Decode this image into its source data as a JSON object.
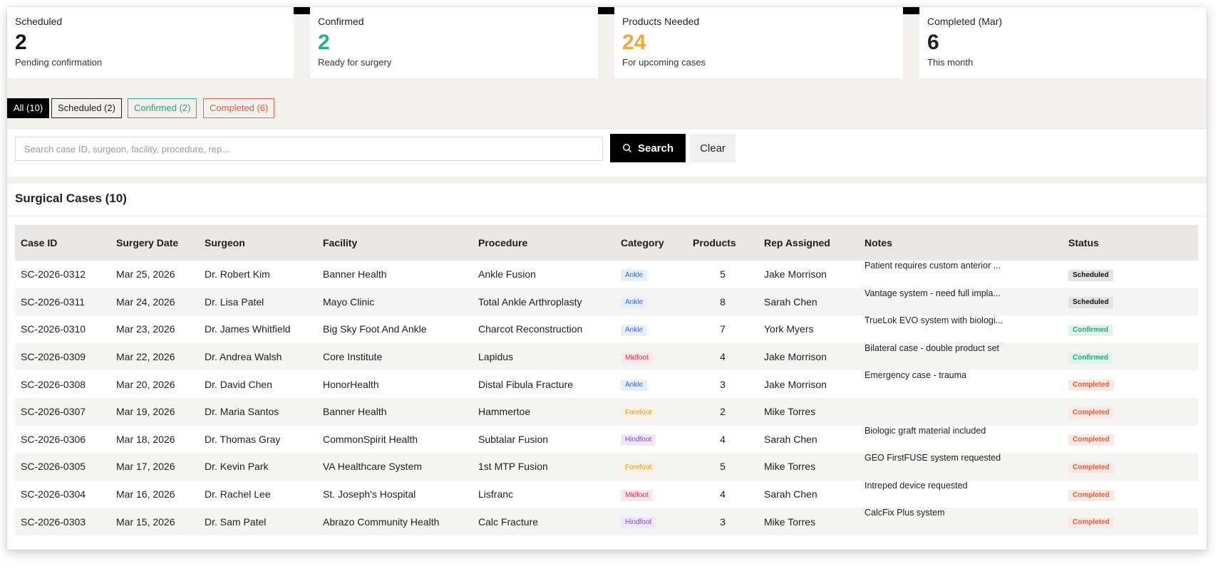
{
  "colors": {
    "confirmed_accent": "#22b28a",
    "products_accent": "#f2a93b",
    "completed_accent": "#e0603f"
  },
  "stats": [
    {
      "label": "Scheduled",
      "value": "2",
      "sub": "Pending confirmation",
      "color": "#111111"
    },
    {
      "label": "Confirmed",
      "value": "2",
      "sub": "Ready for surgery",
      "color": "#22b28a"
    },
    {
      "label": "Products Needed",
      "value": "24",
      "sub": "For upcoming cases",
      "color": "#f2a93b"
    },
    {
      "label": "Completed (Mar)",
      "value": "6",
      "sub": "This month",
      "color": "#222222"
    }
  ],
  "filters": {
    "all": "All (10)",
    "scheduled": "Scheduled (2)",
    "confirmed": "Confirmed (2)",
    "completed": "Completed (6)"
  },
  "search": {
    "placeholder": "Search case ID, surgeon, facility, procedure, rep...",
    "value": "",
    "button_label": "Search",
    "icon": "search-icon",
    "clear_label": "Clear"
  },
  "table": {
    "title": "Surgical Cases (10)",
    "columns": [
      "Case ID",
      "Surgery Date",
      "Surgeon",
      "Facility",
      "Procedure",
      "Category",
      "Products",
      "Rep Assigned",
      "Notes",
      "Status"
    ],
    "rows": [
      {
        "case_id": "SC-2026-0312",
        "date": "Mar 25, 2026",
        "surgeon": "Dr. Robert Kim",
        "facility": "Banner Health",
        "procedure": "Ankle Fusion",
        "category": "Ankle",
        "products": "5",
        "rep": "Jake Morrison",
        "notes": "Patient requires custom anterior ...",
        "status": "Scheduled"
      },
      {
        "case_id": "SC-2026-0311",
        "date": "Mar 24, 2026",
        "surgeon": "Dr. Lisa Patel",
        "facility": "Mayo Clinic",
        "procedure": "Total Ankle Arthroplasty",
        "category": "Ankle",
        "products": "8",
        "rep": "Sarah Chen",
        "notes": "Vantage system - need full impla...",
        "status": "Scheduled"
      },
      {
        "case_id": "SC-2026-0310",
        "date": "Mar 23, 2026",
        "surgeon": "Dr. James Whitfield",
        "facility": "Big Sky Foot And Ankle",
        "procedure": "Charcot Reconstruction",
        "category": "Ankle",
        "products": "7",
        "rep": "York Myers",
        "notes": "TrueLok EVO system with biologi...",
        "status": "Confirmed"
      },
      {
        "case_id": "SC-2026-0309",
        "date": "Mar 22, 2026",
        "surgeon": "Dr. Andrea Walsh",
        "facility": "Core Institute",
        "procedure": "Lapidus",
        "category": "Midfoot",
        "products": "4",
        "rep": "Jake Morrison",
        "notes": "Bilateral case - double product set",
        "status": "Confirmed"
      },
      {
        "case_id": "SC-2026-0308",
        "date": "Mar 20, 2026",
        "surgeon": "Dr. David Chen",
        "facility": "HonorHealth",
        "procedure": "Distal Fibula Fracture",
        "category": "Ankle",
        "products": "3",
        "rep": "Jake Morrison",
        "notes": "Emergency case - trauma",
        "status": "Completed"
      },
      {
        "case_id": "SC-2026-0307",
        "date": "Mar 19, 2026",
        "surgeon": "Dr. Maria Santos",
        "facility": "Banner Health",
        "procedure": "Hammertoe",
        "category": "Forefoot",
        "products": "2",
        "rep": "Mike Torres",
        "notes": "",
        "status": "Completed"
      },
      {
        "case_id": "SC-2026-0306",
        "date": "Mar 18, 2026",
        "surgeon": "Dr. Thomas Gray",
        "facility": "CommonSpirit Health",
        "procedure": "Subtalar Fusion",
        "category": "Hindfoot",
        "products": "4",
        "rep": "Sarah Chen",
        "notes": "Biologic graft material included",
        "status": "Completed"
      },
      {
        "case_id": "SC-2026-0305",
        "date": "Mar 17, 2026",
        "surgeon": "Dr. Kevin Park",
        "facility": "VA Healthcare System",
        "procedure": "1st MTP Fusion",
        "category": "Forefoot",
        "products": "5",
        "rep": "Mike Torres",
        "notes": "GEO FirstFUSE system requested",
        "status": "Completed"
      },
      {
        "case_id": "SC-2026-0304",
        "date": "Mar 16, 2026",
        "surgeon": "Dr. Rachel Lee",
        "facility": "St. Joseph's Hospital",
        "procedure": "Lisfranc",
        "category": "Midfoot",
        "products": "4",
        "rep": "Sarah Chen",
        "notes": "Intreped device requested",
        "status": "Completed"
      },
      {
        "case_id": "SC-2026-0303",
        "date": "Mar 15, 2026",
        "surgeon": "Dr. Sam Patel",
        "facility": "Abrazo Community Health",
        "procedure": "Calc Fracture",
        "category": "Hindfoot",
        "products": "3",
        "rep": "Mike Torres",
        "notes": "CalcFix Plus system",
        "status": "Completed"
      }
    ]
  }
}
